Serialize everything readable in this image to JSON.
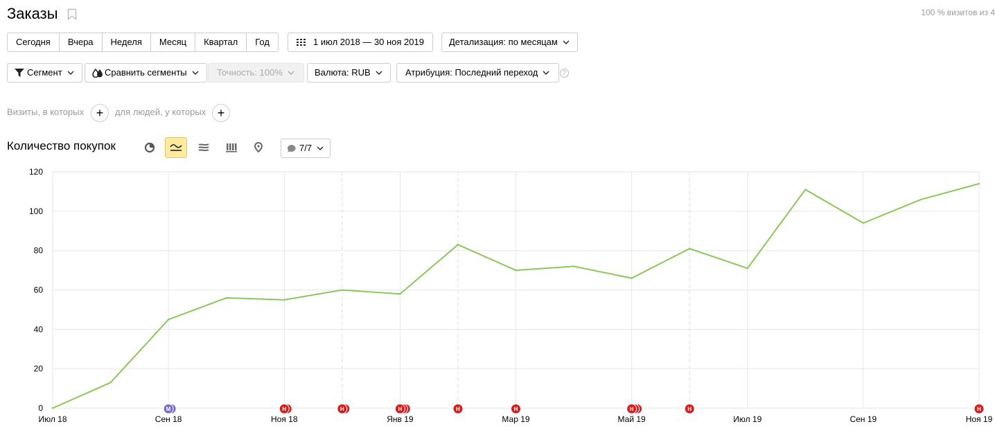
{
  "header": {
    "title": "Заказы",
    "coverage": "100 % визитов из 4"
  },
  "period": {
    "buttons": [
      "Сегодня",
      "Вчера",
      "Неделя",
      "Месяц",
      "Квартал",
      "Год"
    ],
    "range": "1 июл 2018 — 30 ноя 2019",
    "detail": "Детализация: по месяцам"
  },
  "toolbar": {
    "segment": "Сегмент",
    "compare": "Сравнить сегменты",
    "accuracy": "Точность: 100%",
    "currency": "Валюта: RUB",
    "attribution": "Атрибуция: Последний переход",
    "help": "?"
  },
  "filters": {
    "visits_label": "Визиты, в которых",
    "people_label": "для людей, у которых",
    "add": "+"
  },
  "chart_header": {
    "title": "Количество покупок",
    "notes_count": "7/7"
  },
  "chart_data": {
    "type": "line",
    "title": "Количество покупок",
    "x": [
      "2018-07",
      "2018-08",
      "2018-09",
      "2018-10",
      "2018-11",
      "2018-12",
      "2019-01",
      "2019-02",
      "2019-03",
      "2019-04",
      "2019-05",
      "2019-06",
      "2019-07",
      "2019-08",
      "2019-09",
      "2019-10",
      "2019-11"
    ],
    "xticks": [
      {
        "index": 0,
        "label": "Июл 18"
      },
      {
        "index": 2,
        "label": "Сен 18"
      },
      {
        "index": 4,
        "label": "Ноя 18"
      },
      {
        "index": 6,
        "label": "Янв 19"
      },
      {
        "index": 8,
        "label": "Мар 19"
      },
      {
        "index": 10,
        "label": "Май 19"
      },
      {
        "index": 12,
        "label": "Июл 19"
      },
      {
        "index": 14,
        "label": "Сен 19"
      },
      {
        "index": 16,
        "label": "Ноя 19"
      }
    ],
    "yticks": [
      0,
      20,
      40,
      60,
      80,
      100,
      120
    ],
    "ylim": [
      0,
      120
    ],
    "grid": true,
    "series": [
      {
        "color": "#8cc65a",
        "values": [
          0,
          13,
          45,
          56,
          55,
          60,
          58,
          83,
          70,
          72,
          66,
          81,
          71,
          111,
          94,
          106,
          114
        ]
      }
    ],
    "annotations": [
      {
        "index": 2,
        "label": "М",
        "color": "#7b6cc4",
        "stack": 2
      },
      {
        "index": 4,
        "label": "Н",
        "color": "#d41e1e",
        "stack": 2
      },
      {
        "index": 5,
        "label": "Н",
        "color": "#d41e1e",
        "stack": 2
      },
      {
        "index": 6,
        "label": "Н",
        "color": "#d41e1e",
        "stack": 3
      },
      {
        "index": 7,
        "label": "Н",
        "color": "#d41e1e",
        "stack": 1
      },
      {
        "index": 8,
        "label": "Н",
        "color": "#d41e1e",
        "stack": 1
      },
      {
        "index": 10,
        "label": "Н",
        "color": "#d41e1e",
        "stack": 3
      },
      {
        "index": 11,
        "label": "Н",
        "color": "#d41e1e",
        "stack": 1
      },
      {
        "index": 16,
        "label": "Н",
        "color": "#d41e1e",
        "stack": 1
      }
    ],
    "dashed_markers": [
      5,
      7,
      11
    ]
  }
}
